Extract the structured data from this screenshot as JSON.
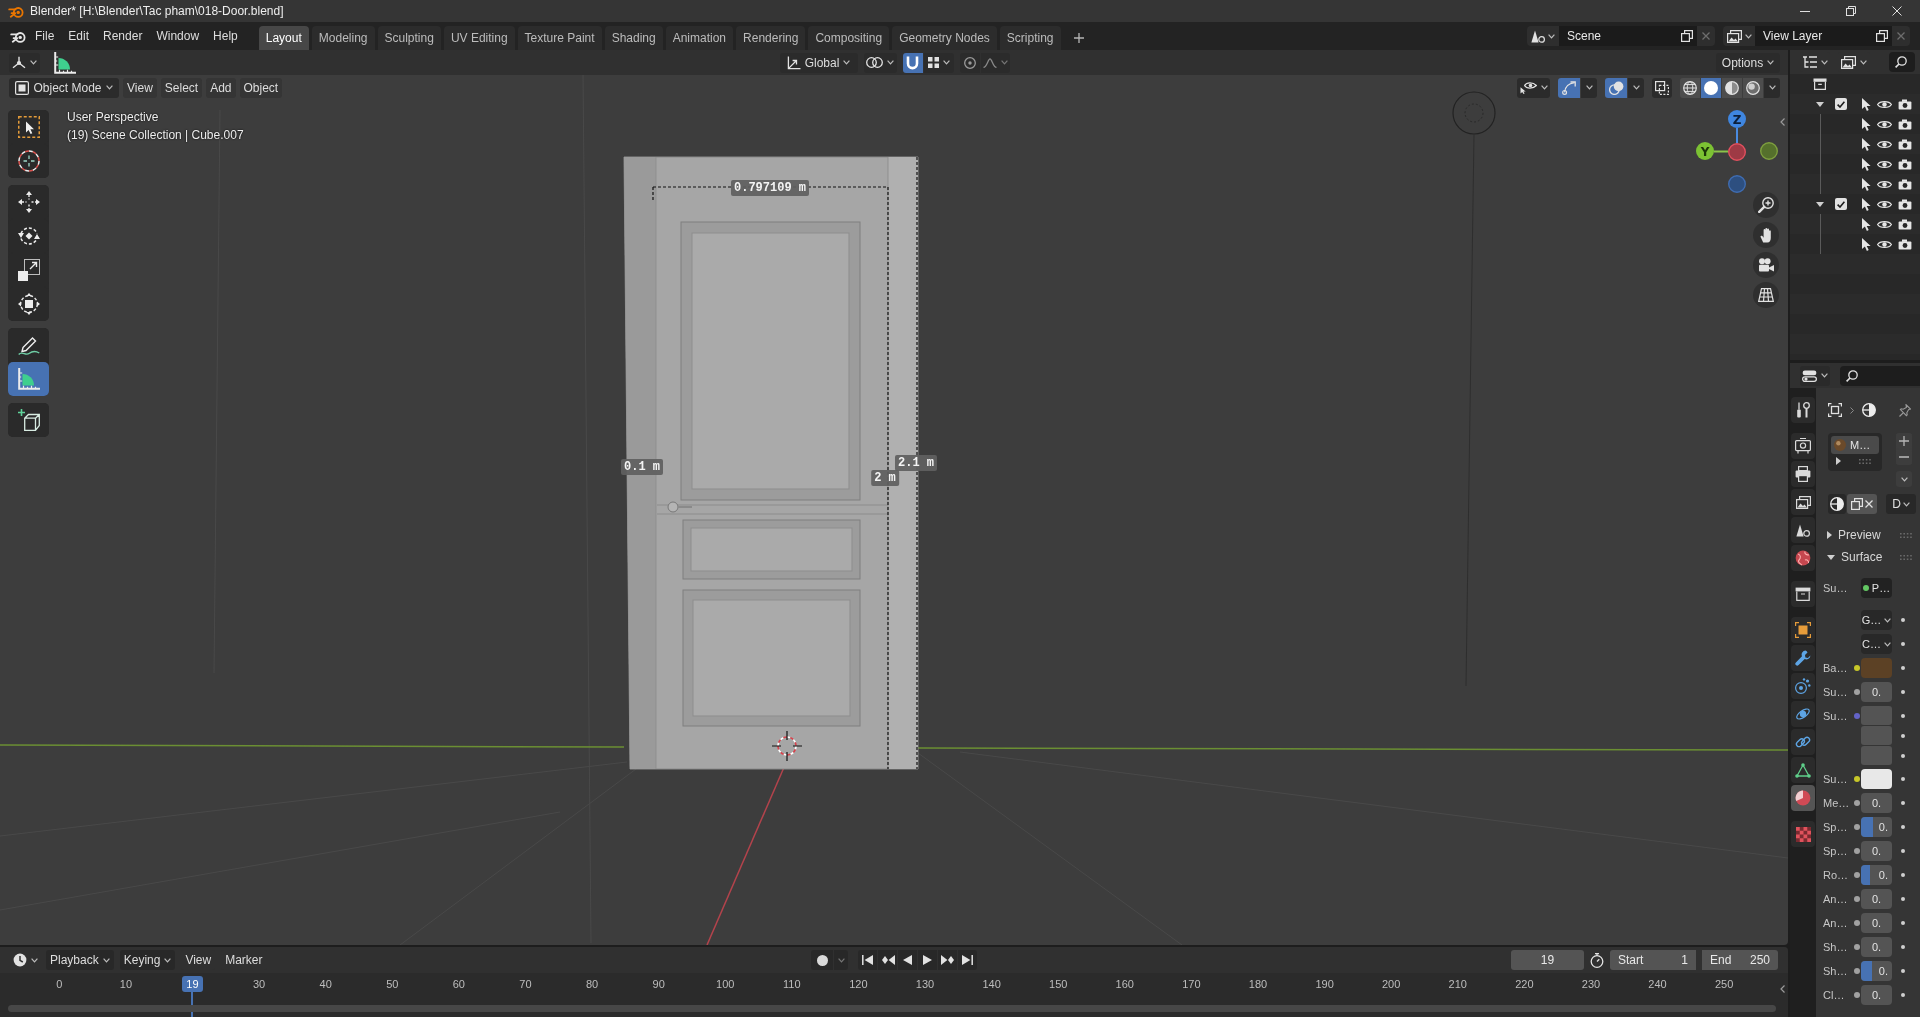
{
  "window": {
    "title": "Blender* [H:\\Blender\\Tac pham\\018-Door.blend]"
  },
  "menu": [
    "File",
    "Edit",
    "Render",
    "Window",
    "Help"
  ],
  "workspaces": [
    {
      "label": "Layout",
      "selected": true
    },
    {
      "label": "Modeling",
      "selected": false
    },
    {
      "label": "Sculpting",
      "selected": false
    },
    {
      "label": "UV Editing",
      "selected": false
    },
    {
      "label": "Texture Paint",
      "selected": false
    },
    {
      "label": "Shading",
      "selected": false
    },
    {
      "label": "Animation",
      "selected": false
    },
    {
      "label": "Rendering",
      "selected": false
    },
    {
      "label": "Compositing",
      "selected": false
    },
    {
      "label": "Geometry Nodes",
      "selected": false
    },
    {
      "label": "Scripting",
      "selected": false
    }
  ],
  "scene": "Scene",
  "view_layer": "View Layer",
  "tool_settings": {
    "orientation": "Global",
    "snap": true,
    "proportional": false,
    "options": "Options"
  },
  "viewport_header": {
    "mode": "Object Mode",
    "menus": [
      "View",
      "Select",
      "Add",
      "Object"
    ],
    "gizmos": true,
    "overlays": true,
    "xray": false,
    "shading": [
      {
        "kind": "wireframe",
        "selected": false
      },
      {
        "kind": "solid",
        "selected": true
      },
      {
        "kind": "material",
        "selected": false
      },
      {
        "kind": "rendered",
        "selected": false
      }
    ]
  },
  "toolbar": [
    [
      {
        "kind": "select_box",
        "selected": false
      },
      {
        "kind": "cursor",
        "selected": false
      }
    ],
    [
      {
        "kind": "move",
        "selected": false
      },
      {
        "kind": "rotate",
        "selected": false
      },
      {
        "kind": "scale",
        "selected": false
      },
      {
        "kind": "transform",
        "selected": false
      }
    ],
    [
      {
        "kind": "annotate",
        "selected": false
      },
      {
        "kind": "measure",
        "selected": true
      }
    ],
    [
      {
        "kind": "add_cube",
        "selected": false
      }
    ]
  ],
  "viewport": {
    "info": [
      "User Perspective",
      "(19) Scene Collection | Cube.007"
    ],
    "measurements": [
      "0.797109 m",
      "0.1 m",
      "2 m",
      "2.1 m"
    ],
    "axis_labels": [
      "Z",
      "Y"
    ]
  },
  "outliner": {
    "collections": [
      {
        "expanded": true,
        "checked": true,
        "visible": true,
        "children": [
          {
            "visible": true
          },
          {
            "visible": true
          },
          {
            "visible": true
          },
          {
            "visible": true
          }
        ]
      },
      {
        "expanded": true,
        "checked": true,
        "visible": true,
        "children": [
          {
            "visible": true
          },
          {
            "visible": true
          }
        ]
      }
    ]
  },
  "properties": {
    "tab_groups": [
      [
        {
          "kind": "tool",
          "selected": false
        }
      ],
      [
        {
          "kind": "render",
          "selected": false
        },
        {
          "kind": "output",
          "selected": false
        },
        {
          "kind": "view_layer",
          "selected": false
        },
        {
          "kind": "scene",
          "selected": false
        },
        {
          "kind": "world",
          "selected": false
        }
      ],
      [
        {
          "kind": "collection",
          "selected": false
        }
      ],
      [
        {
          "kind": "object",
          "selected": false
        },
        {
          "kind": "modifiers",
          "selected": false
        },
        {
          "kind": "particles",
          "selected": false
        },
        {
          "kind": "physics",
          "selected": false
        },
        {
          "kind": "constraints",
          "selected": false
        },
        {
          "kind": "data",
          "selected": false
        },
        {
          "kind": "material",
          "selected": true
        }
      ],
      [
        {
          "kind": "texture",
          "selected": false
        }
      ]
    ],
    "material_slots": [
      {
        "name": "M…",
        "selected": true
      }
    ],
    "link": "D",
    "panels": [
      {
        "label": "Preview",
        "expanded": false
      },
      {
        "label": "Surface",
        "expanded": true
      }
    ],
    "rows": [
      {
        "kind": "node",
        "label": "Su…",
        "value": "P…"
      },
      {
        "kind": "dropdown",
        "value": "G…"
      },
      {
        "kind": "dropdown",
        "value": "C…"
      },
      {
        "kind": "color",
        "label": "Ba…",
        "color": "#5c4125"
      },
      {
        "kind": "number",
        "label": "Su…",
        "value": "0."
      },
      {
        "kind": "vector",
        "label": "Su…"
      },
      {
        "kind": "color",
        "label": "Su…",
        "color": "#e8e8e8"
      },
      {
        "kind": "number",
        "label": "Me…",
        "value": "0."
      },
      {
        "kind": "slider",
        "label": "Sp…",
        "value": "0.",
        "level": 0.4
      },
      {
        "kind": "number",
        "label": "Sp…",
        "value": "0."
      },
      {
        "kind": "slider",
        "label": "Ro…",
        "value": "0.",
        "level": 0.3
      },
      {
        "kind": "number",
        "label": "An…",
        "value": "0."
      },
      {
        "kind": "number",
        "label": "An…",
        "value": "0."
      },
      {
        "kind": "number",
        "label": "Sh…",
        "value": "0."
      },
      {
        "kind": "slider",
        "label": "Sh…",
        "value": "0.",
        "level": 0.35
      },
      {
        "kind": "number",
        "label": "Cl…",
        "value": "0."
      }
    ]
  },
  "timeline": {
    "menus": [
      {
        "kind": "dropdown",
        "label": "Playback"
      },
      {
        "kind": "dropdown",
        "label": "Keying"
      },
      {
        "kind": "menu",
        "label": "View"
      },
      {
        "kind": "menu",
        "label": "Marker"
      }
    ],
    "auto_keying": false,
    "current_frame": "19",
    "start": {
      "label": "Start",
      "value": "1"
    },
    "end": {
      "label": "End",
      "value": "250"
    },
    "ruler": [
      {
        "label": "0",
        "selected": false
      },
      {
        "label": "10",
        "selected": false
      },
      {
        "label": "19",
        "selected": true
      },
      {
        "label": "30",
        "selected": false
      },
      {
        "label": "40",
        "selected": false
      },
      {
        "label": "50",
        "selected": false
      },
      {
        "label": "60",
        "selected": false
      },
      {
        "label": "70",
        "selected": false
      },
      {
        "label": "80",
        "selected": false
      },
      {
        "label": "90",
        "selected": false
      },
      {
        "label": "100",
        "selected": false
      },
      {
        "label": "110",
        "selected": false
      },
      {
        "label": "120",
        "selected": false
      },
      {
        "label": "130",
        "selected": false
      },
      {
        "label": "140",
        "selected": false
      },
      {
        "label": "150",
        "selected": false
      },
      {
        "label": "160",
        "selected": false
      },
      {
        "label": "170",
        "selected": false
      },
      {
        "label": "180",
        "selected": false
      },
      {
        "label": "190",
        "selected": false
      },
      {
        "label": "200",
        "selected": false
      },
      {
        "label": "210",
        "selected": false
      },
      {
        "label": "220",
        "selected": false
      },
      {
        "label": "230",
        "selected": false
      },
      {
        "label": "240",
        "selected": false
      },
      {
        "label": "250",
        "selected": false
      }
    ]
  }
}
